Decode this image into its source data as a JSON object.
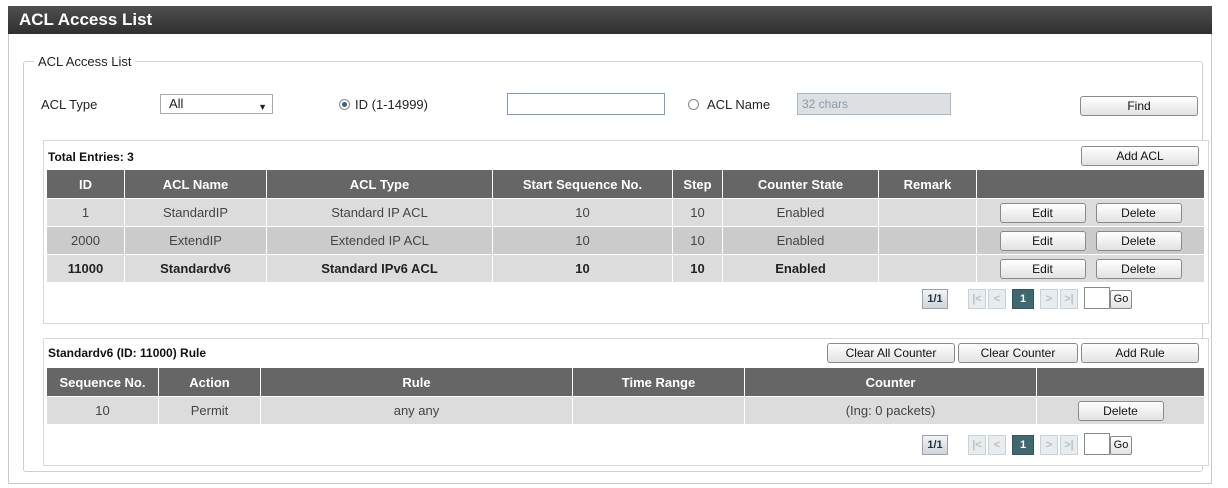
{
  "page": {
    "title": "ACL Access List"
  },
  "filter": {
    "legend": "ACL Access List",
    "acl_type_label": "ACL Type",
    "acl_type_value": "All",
    "id_radio_label": "ID (1-14999)",
    "id_value": "",
    "name_radio_label": "ACL Name",
    "name_placeholder": "32 chars",
    "find_label": "Find"
  },
  "acl_table": {
    "total_entries": "Total Entries: 3",
    "add_label": "Add ACL",
    "headers": [
      "ID",
      "ACL Name",
      "ACL Type",
      "Start Sequence No.",
      "Step",
      "Counter State",
      "Remark",
      ""
    ],
    "rows": [
      {
        "id": "1",
        "name": "StandardIP",
        "type": "Standard IP ACL",
        "start_seq": "10",
        "step": "10",
        "counter_state": "Enabled",
        "remark": "",
        "edit": "Edit",
        "delete": "Delete"
      },
      {
        "id": "2000",
        "name": "ExtendIP",
        "type": "Extended IP ACL",
        "start_seq": "10",
        "step": "10",
        "counter_state": "Enabled",
        "remark": "",
        "edit": "Edit",
        "delete": "Delete"
      },
      {
        "id": "11000",
        "name": "Standardv6",
        "type": "Standard IPv6 ACL",
        "start_seq": "10",
        "step": "10",
        "counter_state": "Enabled",
        "remark": "",
        "edit": "Edit",
        "delete": "Delete"
      }
    ],
    "pager": {
      "info": "1/1",
      "first": "|<",
      "prev": "<",
      "current": "1",
      "next": ">",
      "last": ">|",
      "go": "Go"
    }
  },
  "rule_table": {
    "title": "Standardv6 (ID: 11000) Rule",
    "clear_all_label": "Clear All Counter",
    "clear_label": "Clear Counter",
    "add_label": "Add Rule",
    "headers": [
      "Sequence No.",
      "Action",
      "Rule",
      "Time Range",
      "Counter",
      ""
    ],
    "rows": [
      {
        "seq": "10",
        "action": "Permit",
        "rule": "any any",
        "time_range": "",
        "counter": "(Ing: 0 packets)",
        "delete": "Delete"
      }
    ],
    "pager": {
      "info": "1/1",
      "first": "|<",
      "prev": "<",
      "current": "1",
      "next": ">",
      "last": ">|",
      "go": "Go"
    }
  }
}
